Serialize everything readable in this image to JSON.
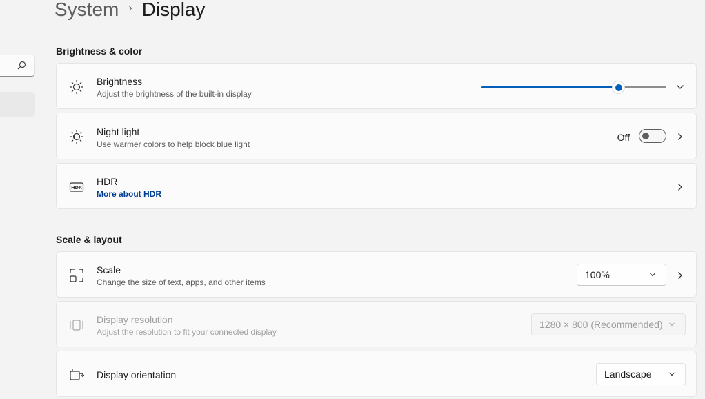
{
  "breadcrumb": {
    "parent": "System",
    "separator": "›",
    "current": "Display"
  },
  "sidebar": {
    "search_icon": "search-icon"
  },
  "sections": {
    "brightness_color": "Brightness & color",
    "scale_layout": "Scale & layout"
  },
  "brightness": {
    "title": "Brightness",
    "subtitle": "Adjust the brightness of the built-in display",
    "level_percent": 74,
    "icon": "sun-icon"
  },
  "night_light": {
    "title": "Night light",
    "subtitle": "Use warmer colors to help block blue light",
    "state_label": "Off",
    "enabled": false,
    "icon": "night-light-icon"
  },
  "hdr": {
    "title": "HDR",
    "link": "More about HDR",
    "icon": "hdr-icon"
  },
  "scale": {
    "title": "Scale",
    "subtitle": "Change the size of text, apps, and other items",
    "value": "100%",
    "icon": "scale-icon"
  },
  "resolution": {
    "title": "Display resolution",
    "subtitle": "Adjust the resolution to fit your connected display",
    "value": "1280 × 800 (Recommended)",
    "icon": "resolution-icon"
  },
  "orientation": {
    "title": "Display orientation",
    "value": "Landscape",
    "icon": "orientation-icon"
  },
  "colors": {
    "accent": "#005fb8",
    "link": "#003e92"
  }
}
